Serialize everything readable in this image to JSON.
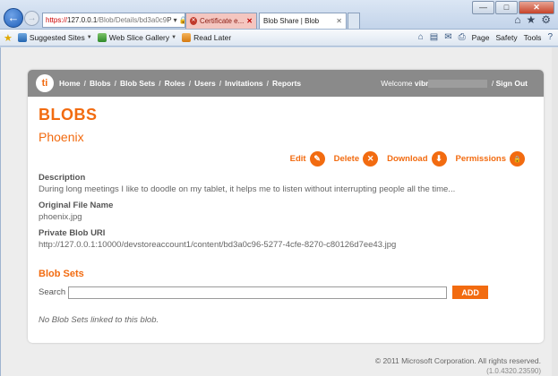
{
  "browser": {
    "address": {
      "scheme": "https://",
      "host": "127.0.0.1",
      "path": "/Blob/Details/bd3a0c9",
      "tools": "P ▾ 🔒"
    },
    "tabs": [
      {
        "label": "Certificate e...",
        "close": "✕"
      },
      {
        "label": "Blob Share | Blob",
        "close": "✕"
      }
    ],
    "window_controls": {
      "minimize": "—",
      "maximize": "□",
      "close": "✕"
    },
    "right_icons": {
      "home": "⌂",
      "favorites": "★",
      "settings": "⚙"
    },
    "favorites_bar": {
      "items": [
        "Suggested Sites",
        "Web Slice Gallery",
        "Read Later"
      ]
    },
    "command_bar": {
      "page": "Page",
      "safety": "Safety",
      "tools": "Tools",
      "help": "?"
    }
  },
  "app": {
    "logo_text": "ti",
    "nav": [
      "Home",
      "Blobs",
      "Blob Sets",
      "Roles",
      "Users",
      "Invitations",
      "Reports"
    ],
    "welcome_prefix": "Welcome",
    "username": "vibr",
    "signout": "Sign Out"
  },
  "page": {
    "title": "BLOBS",
    "blob_name": "Phoenix",
    "actions": [
      {
        "label": "Edit",
        "icon": "pencil-icon",
        "glyph": "✎"
      },
      {
        "label": "Delete",
        "icon": "close-icon",
        "glyph": "✕"
      },
      {
        "label": "Download",
        "icon": "download-icon",
        "glyph": "⬇"
      },
      {
        "label": "Permissions",
        "icon": "lock-icon",
        "glyph": "🔒"
      }
    ],
    "description_label": "Description",
    "description": "During long meetings I like to doodle on my tablet, it helps me to listen without interrupting people all the time...",
    "filename_label": "Original File Name",
    "filename": "phoenix.jpg",
    "uri_label": "Private Blob URI",
    "uri": "http://127.0.0.1:10000/devstoreaccount1/content/bd3a0c96-5277-4cfe-8270-c80126d7ee43.jpg",
    "blob_sets_heading": "Blob Sets",
    "search_label": "Search",
    "search_value": "",
    "add_label": "ADD",
    "empty_message": "No Blob Sets linked to this blob."
  },
  "footer": {
    "copyright": "© 2011 Microsoft Corporation. All rights reserved.",
    "version": "(1.0.4320.23590)"
  },
  "colors": {
    "accent": "#f26b10",
    "navbar": "#8a8a8a"
  }
}
